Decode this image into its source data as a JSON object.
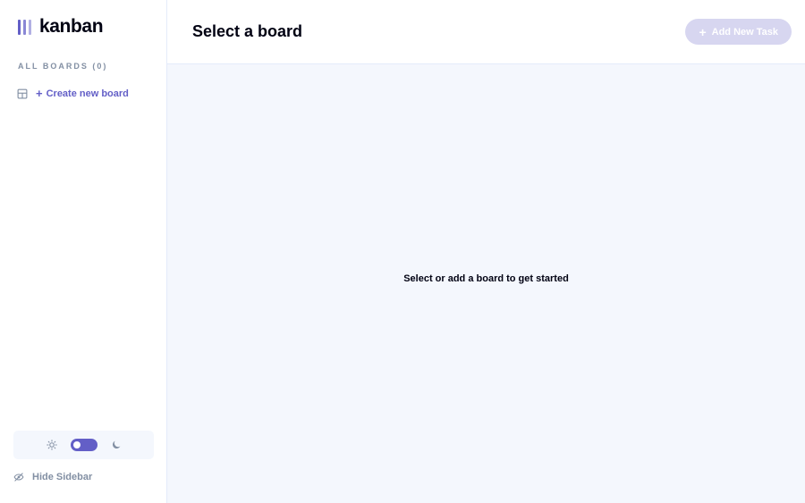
{
  "app": {
    "logo_text": "kanban"
  },
  "colors": {
    "accent": "#635FC7",
    "muted": "#828FA3",
    "text": "#000112",
    "canvas": "#F4F7FD",
    "border": "#E4EBFA"
  },
  "sidebar": {
    "boards_heading": "ALL BOARDS (0)",
    "create_board_label": "Create new board",
    "create_board_icon": "board-icon",
    "theme": {
      "light_icon": "sun-icon",
      "dark_icon": "moon-icon",
      "dark_mode": true
    },
    "hide_sidebar_label": "Hide Sidebar",
    "hide_sidebar_icon": "eye-slash-icon"
  },
  "header": {
    "title": "Select a board",
    "add_task_label": "Add New Task"
  },
  "main": {
    "empty_message": "Select or add a board to get started"
  }
}
